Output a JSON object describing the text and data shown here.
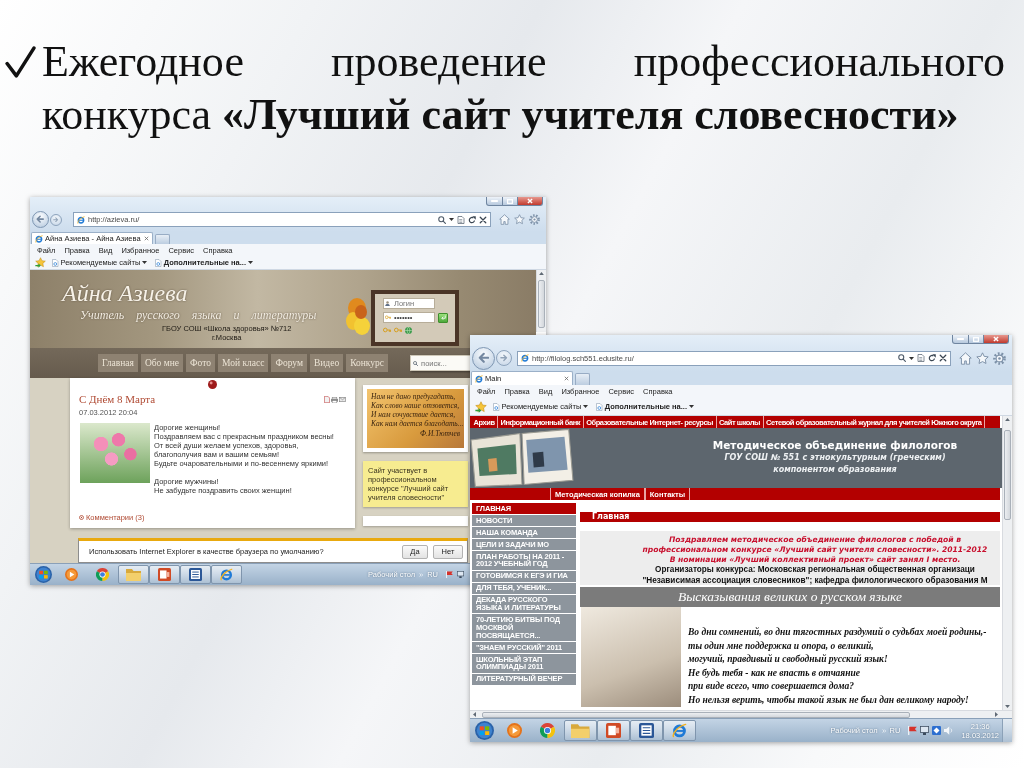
{
  "slide": {
    "title": "Ежегодное проведение профессионального конкурса **«Лучший сайт учителя словесности»**"
  },
  "screenshots": [
    {
      "kind": "personal_site",
      "browser": {
        "url": "http://azieva.ru/",
        "tab": "Айна Азиева - Айна Азиева",
        "menu": [
          "Файл",
          "Правка",
          "Вид",
          "Избранное",
          "Сервис",
          "Справка"
        ],
        "favorites": [
          "Рекомендуемые сайты",
          "Дополнительные на..."
        ]
      },
      "site": {
        "name": "Айна Азиева",
        "subtitle": "Учитель русского языка и литературы",
        "school": "ГБОУ СОШ «Школа здоровья» №712",
        "city": "г.Москва",
        "login": {
          "placeholder": "Логин",
          "password": "•••••••"
        },
        "nav": [
          "Главная",
          "Обо мне",
          "Фото",
          "Мой класс",
          "Форум",
          "Видео",
          "Конкурс"
        ],
        "search": {
          "placeholder": "поиск..."
        },
        "post": {
          "title": "С Днём 8 Марта",
          "date": "07.03.2012 20:04",
          "paragraphs": [
            [
              "Дорогие женщины!",
              "Поздравляем вас с прекрасным праздником весны!",
              "От всей души желаем успехов, здоровья,",
              "благополучия вам и вашим семьям!",
              "Будьте очаровательными и по-весеннему яркими!"
            ],
            [
              "Дорогие мужчины!",
              "Не забудьте поздравить своих женщин!"
            ]
          ],
          "comments": "Комментарии (3)"
        },
        "quote": {
          "lines": [
            "Нам не дано предугадать,",
            "Как слово наше отзовется,",
            "И нам сочувствие дается,",
            "Как нам дается благодать..."
          ],
          "author": "Ф.И.Тютчев"
        },
        "note": "Сайт участвует в профессиональном конкурсе \"Лучший сайт учителя словесности\""
      },
      "notification": {
        "text": "Использовать Internet Explorer в качестве браузера по умолчанию?",
        "buttons": [
          "Да",
          "Нет"
        ]
      },
      "taskbar": {
        "apps": [
          {
            "kind": "media",
            "running": false
          },
          {
            "kind": "tricolor",
            "running": false
          },
          {
            "kind": "folder",
            "running": true
          },
          {
            "kind": "slides",
            "running": true
          },
          {
            "kind": "writer",
            "running": true
          },
          {
            "kind": "browser",
            "running": true
          }
        ],
        "desktop": "Рабочий стол",
        "language": "RU"
      }
    },
    {
      "kind": "school_site",
      "browser": {
        "url": "http://filolog.sch551.edusite.ru/",
        "tab": "Main",
        "menu": [
          "Файл",
          "Правка",
          "Вид",
          "Избранное",
          "Сервис",
          "Справка"
        ],
        "favorites": [
          "Рекомендуемые сайты",
          "Дополнительные на..."
        ]
      },
      "site": {
        "top_nav": [
          "Архив",
          "Информационный банк",
          "Образовательные Интернет- ресурсы",
          "Сайт школы",
          "Сетевой образовательный журнал для учителей Южного округа"
        ],
        "heading": "Методическое объединение филологов",
        "subheading": [
          "ГОУ СОШ № 551 с этнокультурным (греческим)",
          "компонентом образования"
        ],
        "sub_nav": [
          "Методическая копилка",
          "Контакты"
        ],
        "sidebar": [
          {
            "label": "ГЛАВНАЯ",
            "selected": true
          },
          {
            "label": "НОВОСТИ",
            "selected": false
          },
          {
            "label": "НАША КОМАНДА",
            "selected": false
          },
          {
            "label": "ЦЕЛИ И ЗАДАЧИ МО",
            "selected": false
          },
          {
            "label": "ПЛАН РАБОТЫ НА 2011 - 2012 УЧЕБНЫЙ ГОД",
            "selected": false
          },
          {
            "label": "ГОТОВИМСЯ К ЕГЭ И ГИА",
            "selected": false
          },
          {
            "label": "ДЛЯ ТЕБЯ, УЧЕНИК...",
            "selected": false
          },
          {
            "label": "ДЕКАДА РУССКОГО ЯЗЫКА И ЛИТЕРАТУРЫ",
            "selected": false
          },
          {
            "label": "70-ЛЕТИЮ БИТВЫ ПОД МОСКВОЙ ПОСВЯЩАЕТСЯ...",
            "selected": false
          },
          {
            "label": "\"ЗНАЕМ РУССКИЙ\" 2011",
            "selected": false
          },
          {
            "label": "ШКОЛЬНЫЙ ЭТАП ОЛИМПИАДЫ 2011",
            "selected": false
          },
          {
            "label": "ЛИТЕРАТУРНЫЙ ВЕЧЕР",
            "selected": false
          }
        ],
        "page_title": "Главная",
        "announcement": [
          "Поздравляем методическое объединение филологов с победой в",
          "профессиональном конкурсе «Лучший сайт учителя словесности». 2011-2012",
          "В номинации «Лучший коллективный проект» сайт занял I место."
        ],
        "organizers": [
          "Организаторы конкурса: Московская региональная общественная организаци",
          "\"Независимая ассоциация словесников\"; кафедра филологического образования М"
        ],
        "quotes_title": "Высказывания великих о русском языке",
        "quote": [
          "Во дни сомнений, во дни тягостных раздумий о судьбах моей родины,-",
          "ты один мне поддержка и опора, о великий,",
          "могучий, правдивый и свободный русский язык!",
          "Не будь тебя - как не впасть в отчаяние",
          "при виде всего, что совершается дома?",
          "Но нельзя верить, чтобы такой язык не был дан великому народу!"
        ]
      },
      "taskbar": {
        "apps": [
          {
            "kind": "media",
            "running": false
          },
          {
            "kind": "tricolor",
            "running": false
          },
          {
            "kind": "folder",
            "running": true
          },
          {
            "kind": "slides",
            "running": true
          },
          {
            "kind": "writer",
            "running": true
          },
          {
            "kind": "browser",
            "running": true
          }
        ],
        "desktop": "Рабочий стол",
        "language": "RU",
        "time": "21:36",
        "date": "18.03.2012"
      }
    }
  ]
}
